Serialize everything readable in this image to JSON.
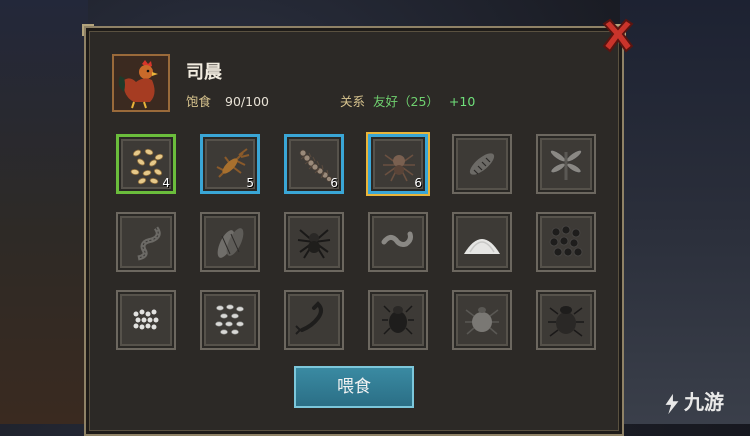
{
  "pet": {
    "name": "司晨",
    "satiety_label": "饱食",
    "satiety_value": "90/100",
    "relation_label": "关系",
    "relation_status": "友好（25）",
    "relation_bonus": "+10"
  },
  "items": [
    {
      "icon": "grain-icon",
      "count": "4",
      "state": "selected-green"
    },
    {
      "icon": "cricket-icon",
      "count": "5",
      "state": "owned"
    },
    {
      "icon": "centipede-icon",
      "count": "6",
      "state": "owned"
    },
    {
      "icon": "spider-brown-icon",
      "count": "6",
      "state": "owned-highlighted"
    },
    {
      "icon": "beetle-grub-icon",
      "count": "",
      "state": "locked"
    },
    {
      "icon": "dragonfly-icon",
      "count": "",
      "state": "locked"
    },
    {
      "icon": "centipede-gray-icon",
      "count": "",
      "state": "locked"
    },
    {
      "icon": "cicada-icon",
      "count": "",
      "state": "locked"
    },
    {
      "icon": "spider-black-icon",
      "count": "",
      "state": "locked"
    },
    {
      "icon": "worm-icon",
      "count": "",
      "state": "locked"
    },
    {
      "icon": "salt-pile-icon",
      "count": "",
      "state": "locked"
    },
    {
      "icon": "black-beans-icon",
      "count": "",
      "state": "locked"
    },
    {
      "icon": "white-seeds-icon",
      "count": "",
      "state": "locked"
    },
    {
      "icon": "rice-grains-icon",
      "count": "",
      "state": "locked"
    },
    {
      "icon": "scorpion-icon",
      "count": "",
      "state": "locked"
    },
    {
      "icon": "stag-beetle-icon",
      "count": "",
      "state": "locked"
    },
    {
      "icon": "tick-icon",
      "count": "",
      "state": "locked"
    },
    {
      "icon": "scarab-icon",
      "count": "",
      "state": "locked"
    }
  ],
  "feed_button": "喂食",
  "watermark": "九游",
  "colors": {
    "slot_green": "#6bbd3c",
    "slot_blue": "#3aa6d6",
    "slot_gold": "#e8b43a",
    "button": "#2b6f86"
  }
}
